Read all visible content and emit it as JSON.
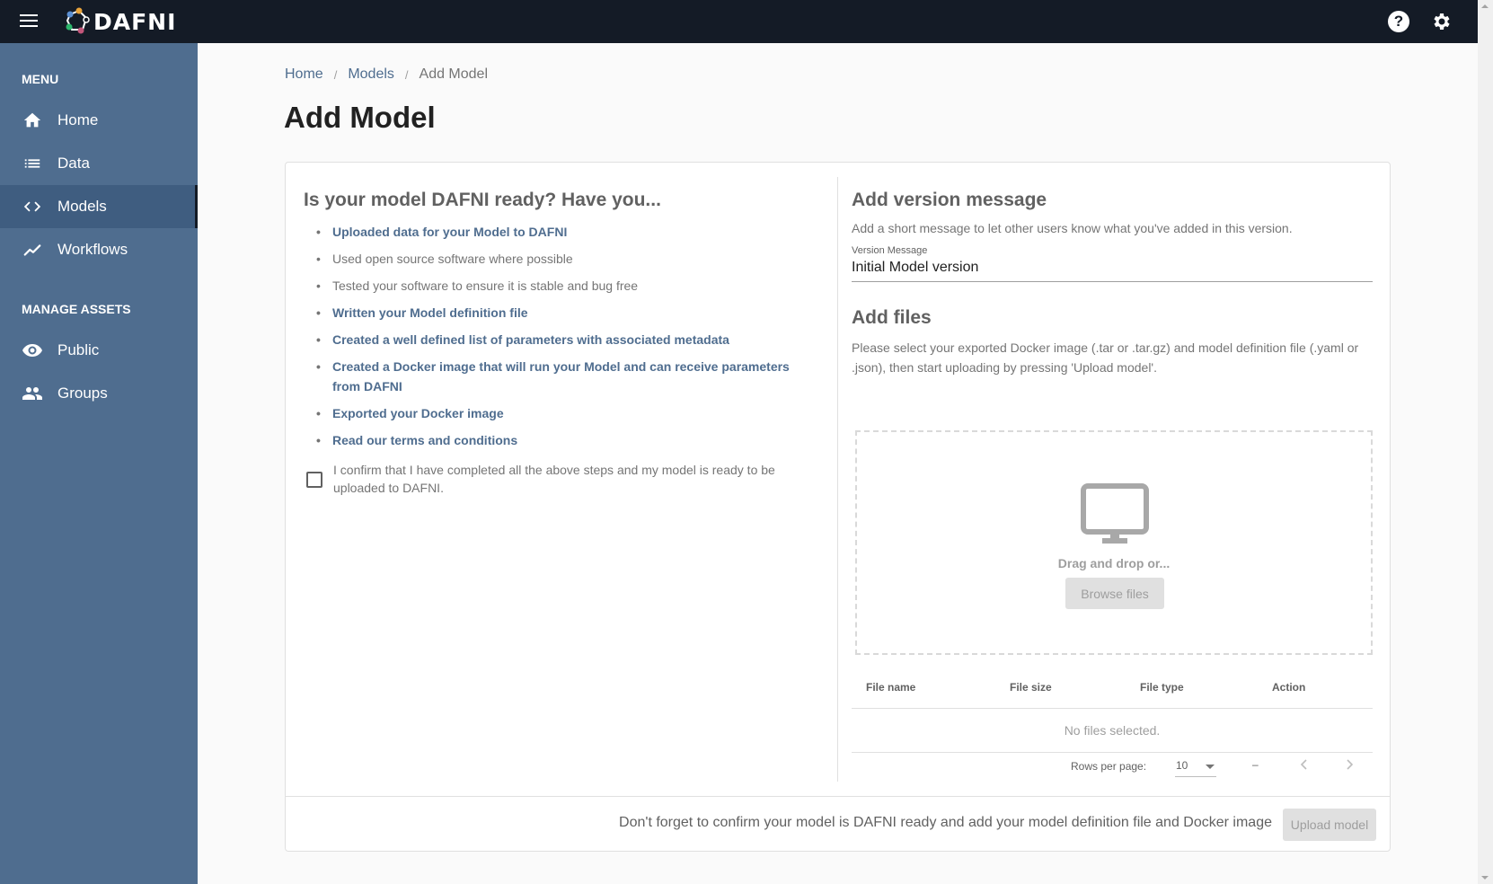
{
  "header": {
    "logo_text": "DAFNI",
    "help_glyph": "?",
    "icons": [
      "menu-icon",
      "dafni-logo",
      "help-icon",
      "gear-icon"
    ]
  },
  "sidebar": {
    "menu_heading": "MENU",
    "items": [
      {
        "label": "Home",
        "icon": "home-icon",
        "active": false
      },
      {
        "label": "Data",
        "icon": "list-icon",
        "active": false
      },
      {
        "label": "Models",
        "icon": "code-icon",
        "active": true
      },
      {
        "label": "Workflows",
        "icon": "trend-icon",
        "active": false
      }
    ],
    "assets_heading": "MANAGE ASSETS",
    "asset_items": [
      {
        "label": "Public",
        "icon": "eye-icon"
      },
      {
        "label": "Groups",
        "icon": "people-icon"
      }
    ]
  },
  "breadcrumb": {
    "items": [
      "Home",
      "Models"
    ],
    "separator": "/",
    "current": "Add Model"
  },
  "page_title": "Add Model",
  "checklist": {
    "title": "Is your model DAFNI ready? Have you...",
    "items": [
      {
        "text": "Uploaded data for your Model to DAFNI",
        "link": true
      },
      {
        "text": "Used open source software where possible",
        "link": false
      },
      {
        "text": "Tested your software to ensure it is stable and bug free",
        "link": false
      },
      {
        "text": "Written your Model definition file",
        "link": true
      },
      {
        "text": "Created a well defined list of parameters with associated metadata",
        "link": true
      },
      {
        "text": "Created a Docker image that will run your Model and can receive parameters from DAFNI",
        "link": true
      },
      {
        "text": "Exported your Docker image",
        "link": true
      },
      {
        "text": "Read our terms and conditions",
        "link": true
      }
    ],
    "confirm_text": "I confirm that I have completed all the above steps and my model is ready to be uploaded to DAFNI.",
    "confirm_checked": false
  },
  "version": {
    "title": "Add version message",
    "description": "Add a short message to let other users know what you've added in this version.",
    "field_label": "Version Message",
    "field_value": "Initial Model version"
  },
  "files": {
    "title": "Add files",
    "description": "Please select your exported Docker image (.tar or .tar.gz) and model definition file (.yaml or .json), then start uploading by pressing 'Upload model'.",
    "drag_text": "Drag and drop or...",
    "browse_label": "Browse files",
    "columns": [
      "File name",
      "File size",
      "File type",
      "Action"
    ],
    "empty_text": "No files selected.",
    "pagination": {
      "rows_label": "Rows per page:",
      "rows_value": "10",
      "range": "–"
    }
  },
  "footer": {
    "message": "Don't forget to confirm your model is DAFNI ready and add your model definition file and Docker image",
    "upload_label": "Upload model"
  }
}
